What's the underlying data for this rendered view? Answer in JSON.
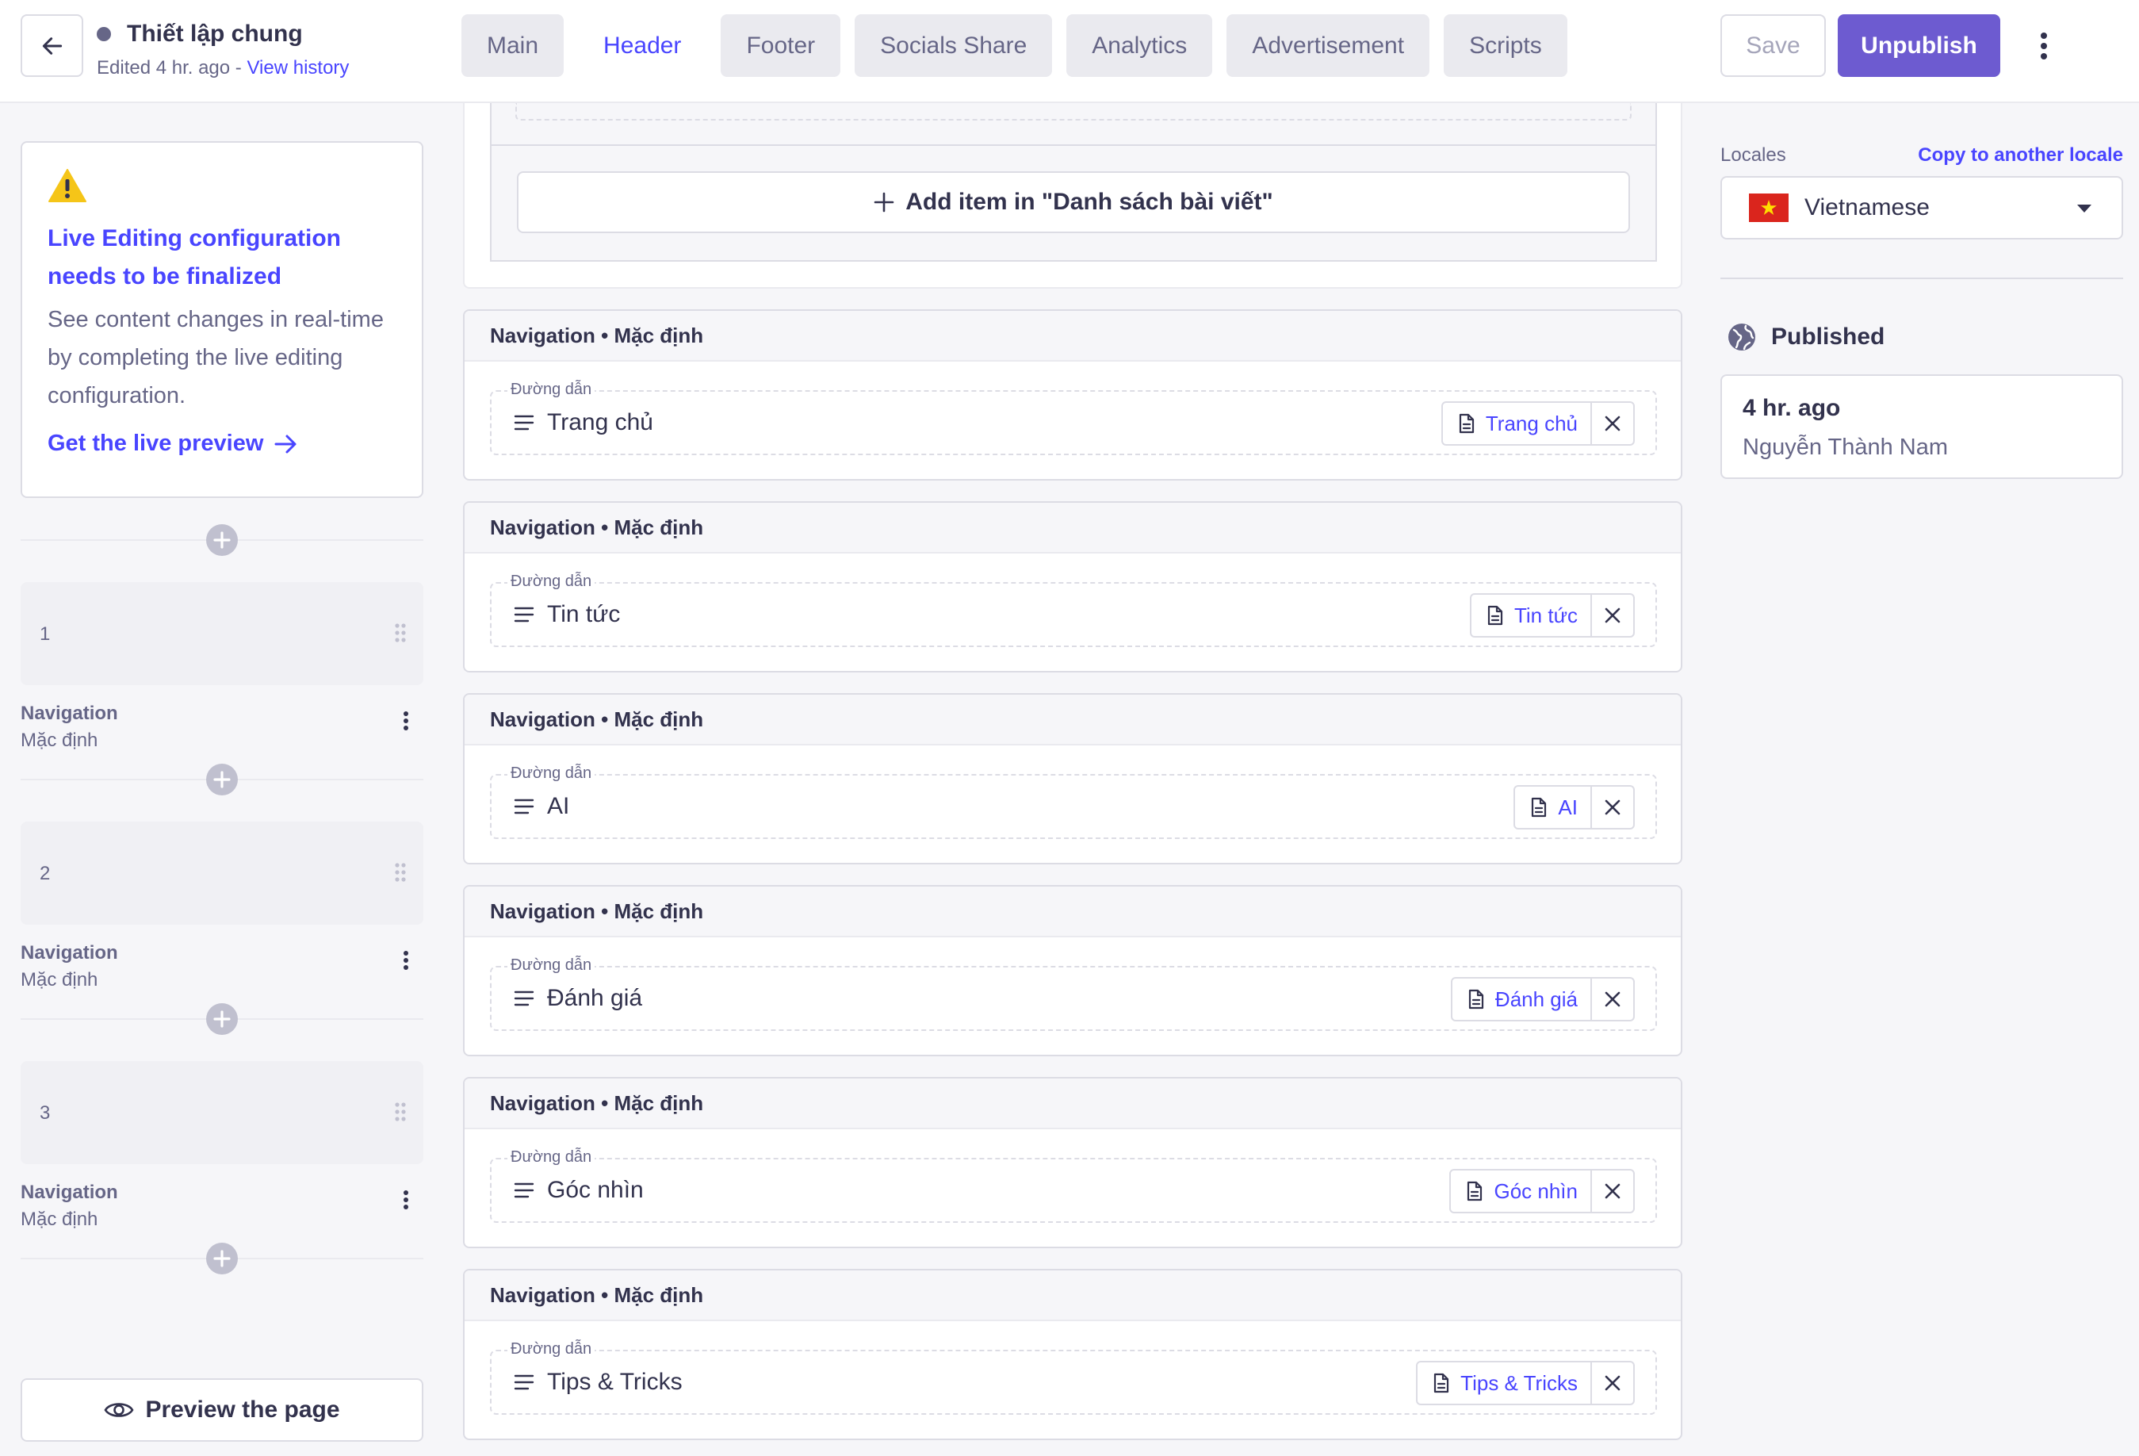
{
  "header": {
    "title": "Thiết lập chung",
    "edited_text": "Edited 4 hr. ago - ",
    "view_history": "View history",
    "tabs": [
      {
        "label": "Main",
        "active": false
      },
      {
        "label": "Header",
        "active": true
      },
      {
        "label": "Footer",
        "active": false
      },
      {
        "label": "Socials Share",
        "active": false
      },
      {
        "label": "Analytics",
        "active": false
      },
      {
        "label": "Advertisement",
        "active": false
      },
      {
        "label": "Scripts",
        "active": false
      }
    ],
    "save_label": "Save",
    "unpublish_label": "Unpublish"
  },
  "colors": {
    "accent": "#4945ff",
    "primary_button": "#6d5bd0",
    "warning": "#f5c518",
    "flag_red": "#da251d"
  },
  "live_editing": {
    "title": "Live Editing configuration needs to be finalized",
    "text": "See content changes in real-time by completing the live editing configuration.",
    "link": "Get the live preview"
  },
  "zones": [
    {
      "number": "1",
      "name": "Navigation",
      "variant": "Mặc định"
    },
    {
      "number": "2",
      "name": "Navigation",
      "variant": "Mặc định"
    },
    {
      "number": "3",
      "name": "Navigation",
      "variant": "Mặc định"
    }
  ],
  "preview_label": "Preview the page",
  "main": {
    "add_item_label": "Add item in \"Danh sách bài viết\"",
    "nav_cards": [
      {
        "title": "Navigation • Mặc định",
        "field_label": "Đường dẫn",
        "value": "Trang chủ",
        "link": "Trang chủ"
      },
      {
        "title": "Navigation • Mặc định",
        "field_label": "Đường dẫn",
        "value": "Tin tức",
        "link": "Tin tức"
      },
      {
        "title": "Navigation • Mặc định",
        "field_label": "Đường dẫn",
        "value": "AI",
        "link": "AI"
      },
      {
        "title": "Navigation • Mặc định",
        "field_label": "Đường dẫn",
        "value": "Đánh giá",
        "link": "Đánh giá"
      },
      {
        "title": "Navigation • Mặc định",
        "field_label": "Đường dẫn",
        "value": "Góc nhìn",
        "link": "Góc nhìn"
      },
      {
        "title": "Navigation • Mặc định",
        "field_label": "Đường dẫn",
        "value": "Tips & Tricks",
        "link": "Tips & Tricks"
      }
    ]
  },
  "sidebar": {
    "locales_label": "Locales",
    "copy_locale": "Copy to another locale",
    "locale_value": "Vietnamese",
    "status_label": "Published",
    "published_time": "4 hr. ago",
    "published_by": "Nguyễn Thành Nam"
  }
}
